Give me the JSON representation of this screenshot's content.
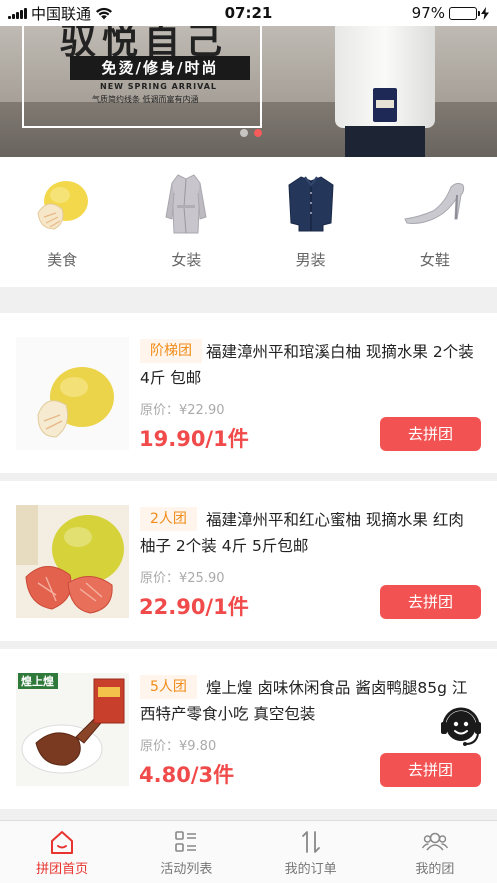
{
  "status_bar": {
    "carrier": "中国联通",
    "time": "07:21",
    "battery_percent": "97%",
    "battery_level": 0.97
  },
  "banner": {
    "title": "驭悦自己",
    "slogan": "免烫/修身/时尚",
    "subtitle_en": "NEW SPRING ARRIVAL",
    "subtitle_cn": "气质简约线条  低调而富有内涵",
    "page_count": 2,
    "active_page": 2
  },
  "categories": [
    {
      "label": "美食",
      "icon": "pomelo-icon"
    },
    {
      "label": "女装",
      "icon": "coat-icon"
    },
    {
      "label": "男装",
      "icon": "shirt-icon"
    },
    {
      "label": "女鞋",
      "icon": "high-heel-icon"
    }
  ],
  "products": [
    {
      "tag": "阶梯团",
      "title": "福建漳州平和琯溪白柚 现摘水果 2个装 4斤 包邮",
      "original_price": "原价：¥22.90",
      "price": "19.90/1件",
      "button": "去拼团"
    },
    {
      "tag": "2人团",
      "title": "福建漳州平和红心蜜柚 现摘水果 红肉柚子 2个装 4斤 5斤包邮",
      "original_price": "原价：¥25.90",
      "price": "22.90/1件",
      "button": "去拼团"
    },
    {
      "tag": "5人团",
      "title": "煌上煌 卤味休闲食品 酱卤鸭腿85g 江西特产零食小吃 真空包装",
      "original_price": "原价：¥9.80",
      "price": "4.80/3件",
      "button": "去拼团",
      "thumb_brand": "煌上煌"
    }
  ],
  "tabbar": [
    {
      "label": "拼团首页",
      "icon": "home-icon",
      "active": true
    },
    {
      "label": "活动列表",
      "icon": "list-icon",
      "active": false
    },
    {
      "label": "我的订单",
      "icon": "sort-icon",
      "active": false
    },
    {
      "label": "我的团",
      "icon": "group-icon",
      "active": false
    }
  ],
  "colors": {
    "accent": "#f25252",
    "price": "#f04a4a",
    "tag_text": "#f08c1a",
    "tab_active": "#e8342e"
  }
}
